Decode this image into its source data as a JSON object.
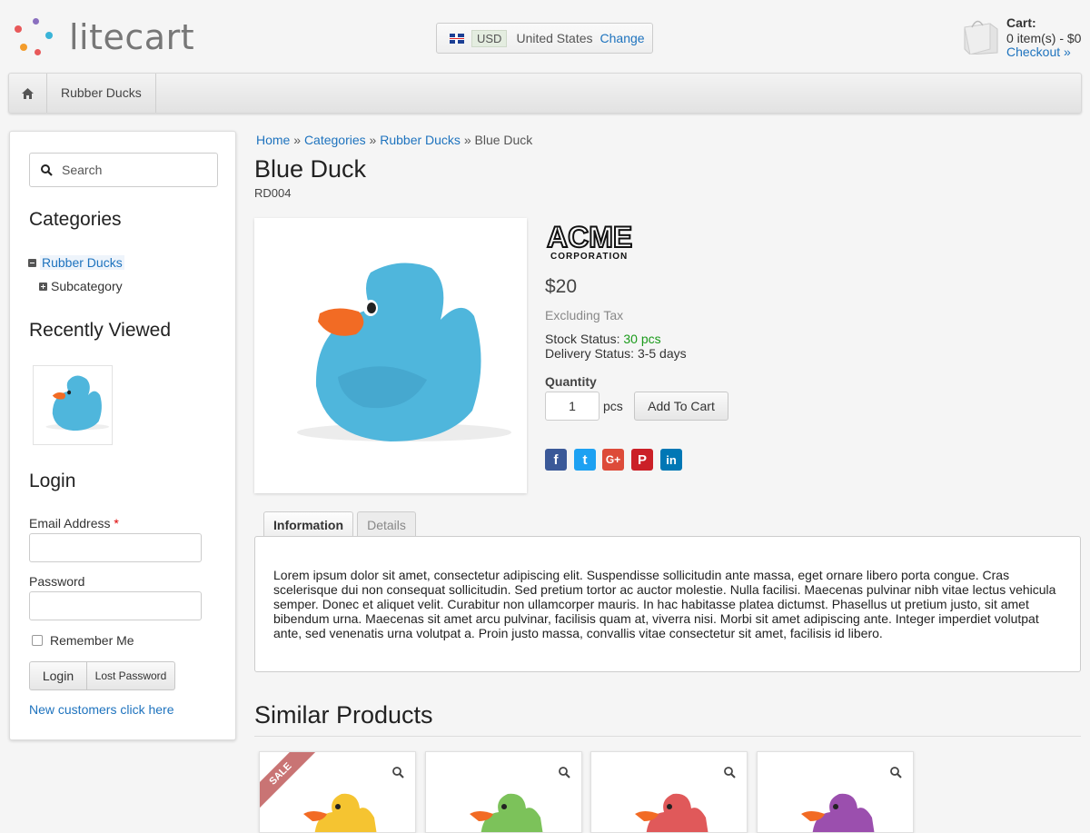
{
  "header": {
    "logo_text": "litecart",
    "region": {
      "currency": "USD",
      "country": "United States",
      "change_label": "Change"
    },
    "cart": {
      "title": "Cart:",
      "items": "0 item(s) - $0",
      "checkout_label": "Checkout »"
    }
  },
  "nav": {
    "items": [
      {
        "label": "Rubber Ducks"
      }
    ]
  },
  "sidebar": {
    "search_placeholder": "Search",
    "categories_title": "Categories",
    "categories": [
      {
        "label": "Rubber Ducks"
      },
      {
        "label": "Subcategory"
      }
    ],
    "recently_viewed_title": "Recently Viewed",
    "login": {
      "title": "Login",
      "email_label": "Email Address",
      "required_mark": "*",
      "password_label": "Password",
      "remember_label": "Remember Me",
      "login_button": "Login",
      "lost_password_button": "Lost Password",
      "new_customers_link": "New customers click here"
    }
  },
  "breadcrumb": {
    "items": [
      "Home",
      "Categories",
      "Rubber Ducks"
    ],
    "separator": "»",
    "current": "Blue Duck"
  },
  "product": {
    "title": "Blue Duck",
    "sku": "RD004",
    "brand_line1": "ACME",
    "brand_line2": "CORPORATION",
    "price": "$20",
    "tax_note": "Excluding Tax",
    "stock_label": "Stock Status:",
    "stock_value": "30 pcs",
    "delivery_label": "Delivery Status:",
    "delivery_value": "3-5 days",
    "quantity_label": "Quantity",
    "quantity_value": "1",
    "unit": "pcs",
    "add_to_cart": "Add To Cart",
    "duck_color": "#4fb6dc"
  },
  "social": [
    {
      "name": "facebook-icon",
      "glyph": "f",
      "color": "#3b5998"
    },
    {
      "name": "twitter-icon",
      "glyph": "t",
      "color": "#1da1f2"
    },
    {
      "name": "google-plus-icon",
      "glyph": "G+",
      "color": "#dd4b39"
    },
    {
      "name": "pinterest-icon",
      "glyph": "P",
      "color": "#cb2027"
    },
    {
      "name": "linkedin-icon",
      "glyph": "in",
      "color": "#0077b5"
    }
  ],
  "tabs": [
    {
      "label": "Information"
    },
    {
      "label": "Details"
    }
  ],
  "description": "Lorem ipsum dolor sit amet, consectetur adipiscing elit. Suspendisse sollicitudin ante massa, eget ornare libero porta congue. Cras scelerisque dui non consequat sollicitudin. Sed pretium tortor ac auctor molestie. Nulla facilisi. Maecenas pulvinar nibh vitae lectus vehicula semper. Donec et aliquet velit. Curabitur non ullamcorper mauris. In hac habitasse platea dictumst. Phasellus ut pretium justo, sit amet bibendum urna. Maecenas sit amet arcu pulvinar, facilisis quam at, viverra nisi. Morbi sit amet adipiscing ante. Integer imperdiet volutpat ante, sed venenatis urna volutpat a. Proin justo massa, convallis vitae consectetur sit amet, facilisis id libero.",
  "similar": {
    "title": "Similar Products",
    "products": [
      {
        "color": "#f5c431",
        "sale_label": "SALE"
      },
      {
        "color": "#7cc25a"
      },
      {
        "color": "#e0595a"
      },
      {
        "color": "#9b4fae"
      }
    ]
  }
}
